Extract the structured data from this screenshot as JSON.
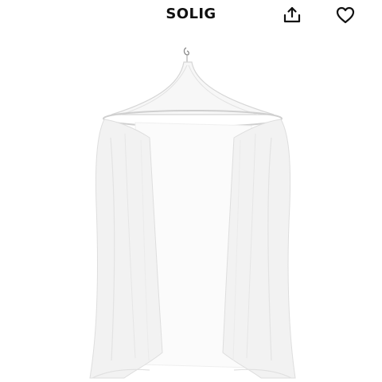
{
  "header": {
    "title": "SOLIG",
    "share_icon": "share-icon",
    "favorite_icon": "heart-icon"
  },
  "product_image": {
    "subject": "canopy-image"
  }
}
